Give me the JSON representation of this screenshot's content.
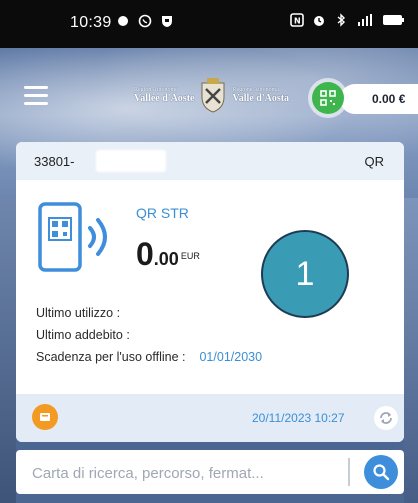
{
  "status_bar": {
    "time": "10:39"
  },
  "header": {
    "logo_left_small": "Région Autonome",
    "logo_left": "Vallée d'Aoste",
    "logo_right_small": "Regione Autonoma",
    "logo_right": "Valle d'Aosta",
    "balance": "0.00 €"
  },
  "card": {
    "number": "33801-",
    "type": "QR",
    "name": "QR STR",
    "amount_int": "0",
    "amount_dec": ".00",
    "currency": "EUR",
    "badge": "1",
    "last_use_label": "Ultimo utilizzo :",
    "last_charge_label": "Ultimo addebito :",
    "offline_expiry_label": "Scadenza per l'uso offline :",
    "offline_expiry_value": "01/01/2030",
    "updated": "20/11/2023 10:27"
  },
  "search": {
    "placeholder": "Carta di ricerca, percorso, fermat..."
  },
  "colors": {
    "accent": "#3a8fd6",
    "qr_button": "#3fb64d",
    "orange": "#f39a22",
    "badge": "#3a9bb5"
  }
}
